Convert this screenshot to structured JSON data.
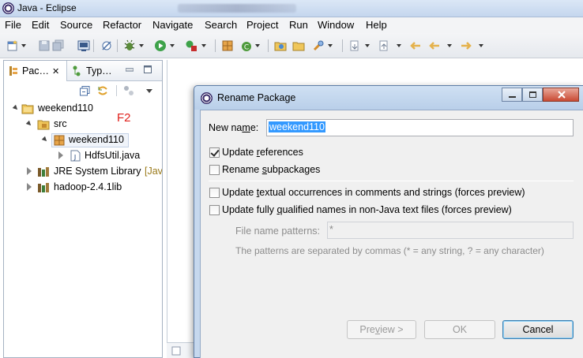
{
  "window": {
    "title": "Java - Eclipse"
  },
  "menu": [
    "File",
    "Edit",
    "Source",
    "Refactor",
    "Navigate",
    "Search",
    "Project",
    "Run",
    "Window",
    "Help"
  ],
  "package_explorer": {
    "tabs": [
      {
        "label": "Pac…",
        "close": "✕"
      },
      {
        "label": "Typ…"
      }
    ],
    "tree": [
      {
        "label": "weekend110",
        "icon": "java-project-icon",
        "expanded": true
      },
      {
        "label": "src",
        "icon": "source-folder-icon",
        "expanded": true
      },
      {
        "label": "weekend110",
        "icon": "package-icon",
        "expanded": true,
        "selected": true
      },
      {
        "label": "HdfsUtil.java",
        "icon": "java-file-icon",
        "expanded": false
      },
      {
        "label": "JRE System Library",
        "suffix": "[Jav",
        "icon": "library-icon",
        "expanded": false
      },
      {
        "label": "hadoop-2.4.1lib",
        "icon": "library-icon",
        "expanded": false
      }
    ],
    "annotation": "F2"
  },
  "dialog": {
    "title": "Rename Package",
    "new_name_label": "New name:",
    "new_name_value": "weekend110",
    "update_references": "Update references",
    "rename_subpackages": "Rename subpackages",
    "update_textual": "Update textual occurrences in comments and strings (forces preview)",
    "update_qualified": "Update fully qualified names in non-Java text files (forces preview)",
    "file_name_patterns_label": "File name patterns:",
    "file_name_patterns_value": "*",
    "patterns_hint": "The patterns are separated by commas (* = any string, ? = any character)",
    "buttons": {
      "preview": "Preview >",
      "ok": "OK",
      "cancel": "Cancel"
    },
    "checks": {
      "update_references": true,
      "rename_subpackages": false,
      "update_textual": false,
      "update_qualified": false
    }
  },
  "colors": {
    "selection": "#3399ff",
    "annotation": "#e0201b"
  }
}
